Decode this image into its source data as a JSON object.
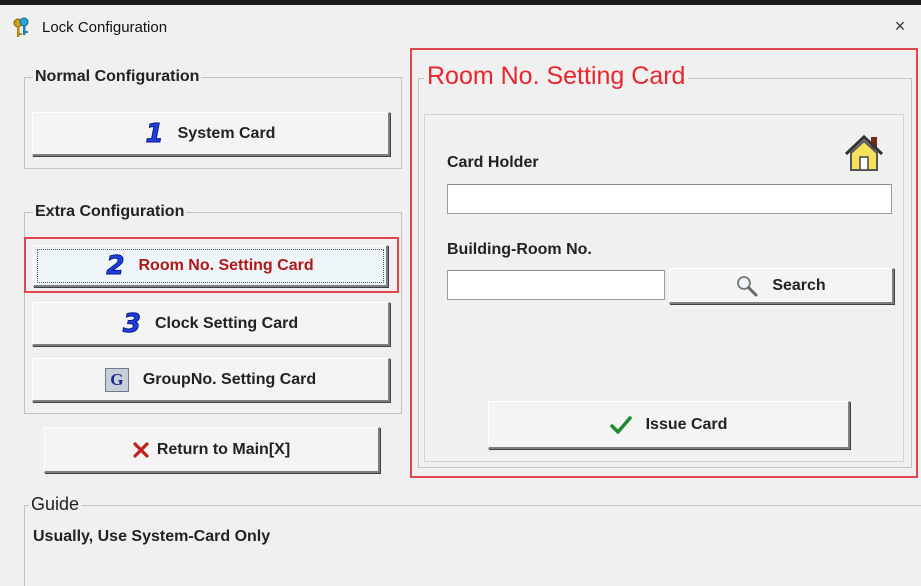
{
  "window": {
    "title": "Lock Configuration",
    "close_glyph": "×"
  },
  "normal_config": {
    "legend": "Normal Configuration",
    "system_card": {
      "number": "1",
      "label": "System Card"
    }
  },
  "extra_config": {
    "legend": "Extra Configuration",
    "room_card": {
      "number": "2",
      "label": "Room No. Setting Card"
    },
    "clock_card": {
      "number": "3",
      "label": "Clock Setting Card"
    },
    "group_card": {
      "badge": "G",
      "label": "GroupNo. Setting Card"
    }
  },
  "return_button": {
    "label": "Return to Main[X]"
  },
  "room_panel": {
    "title": "Room No. Setting Card",
    "card_holder_label": "Card Holder",
    "card_holder_value": "",
    "building_room_label": "Building-Room No.",
    "building_room_value": "",
    "search_label": "Search",
    "issue_label": "Issue Card"
  },
  "guide": {
    "legend": "Guide",
    "text": "Usually, Use System-Card Only"
  },
  "colors": {
    "accent_red": "#e0474c",
    "title_red": "#e8262c",
    "number_blue": "#1f3fe0",
    "check_green": "#1e8a2e",
    "x_red": "#c0201c"
  },
  "icons": [
    "keys-icon",
    "close-icon",
    "house-icon",
    "search-icon",
    "checkmark-icon",
    "x-mark-icon"
  ]
}
